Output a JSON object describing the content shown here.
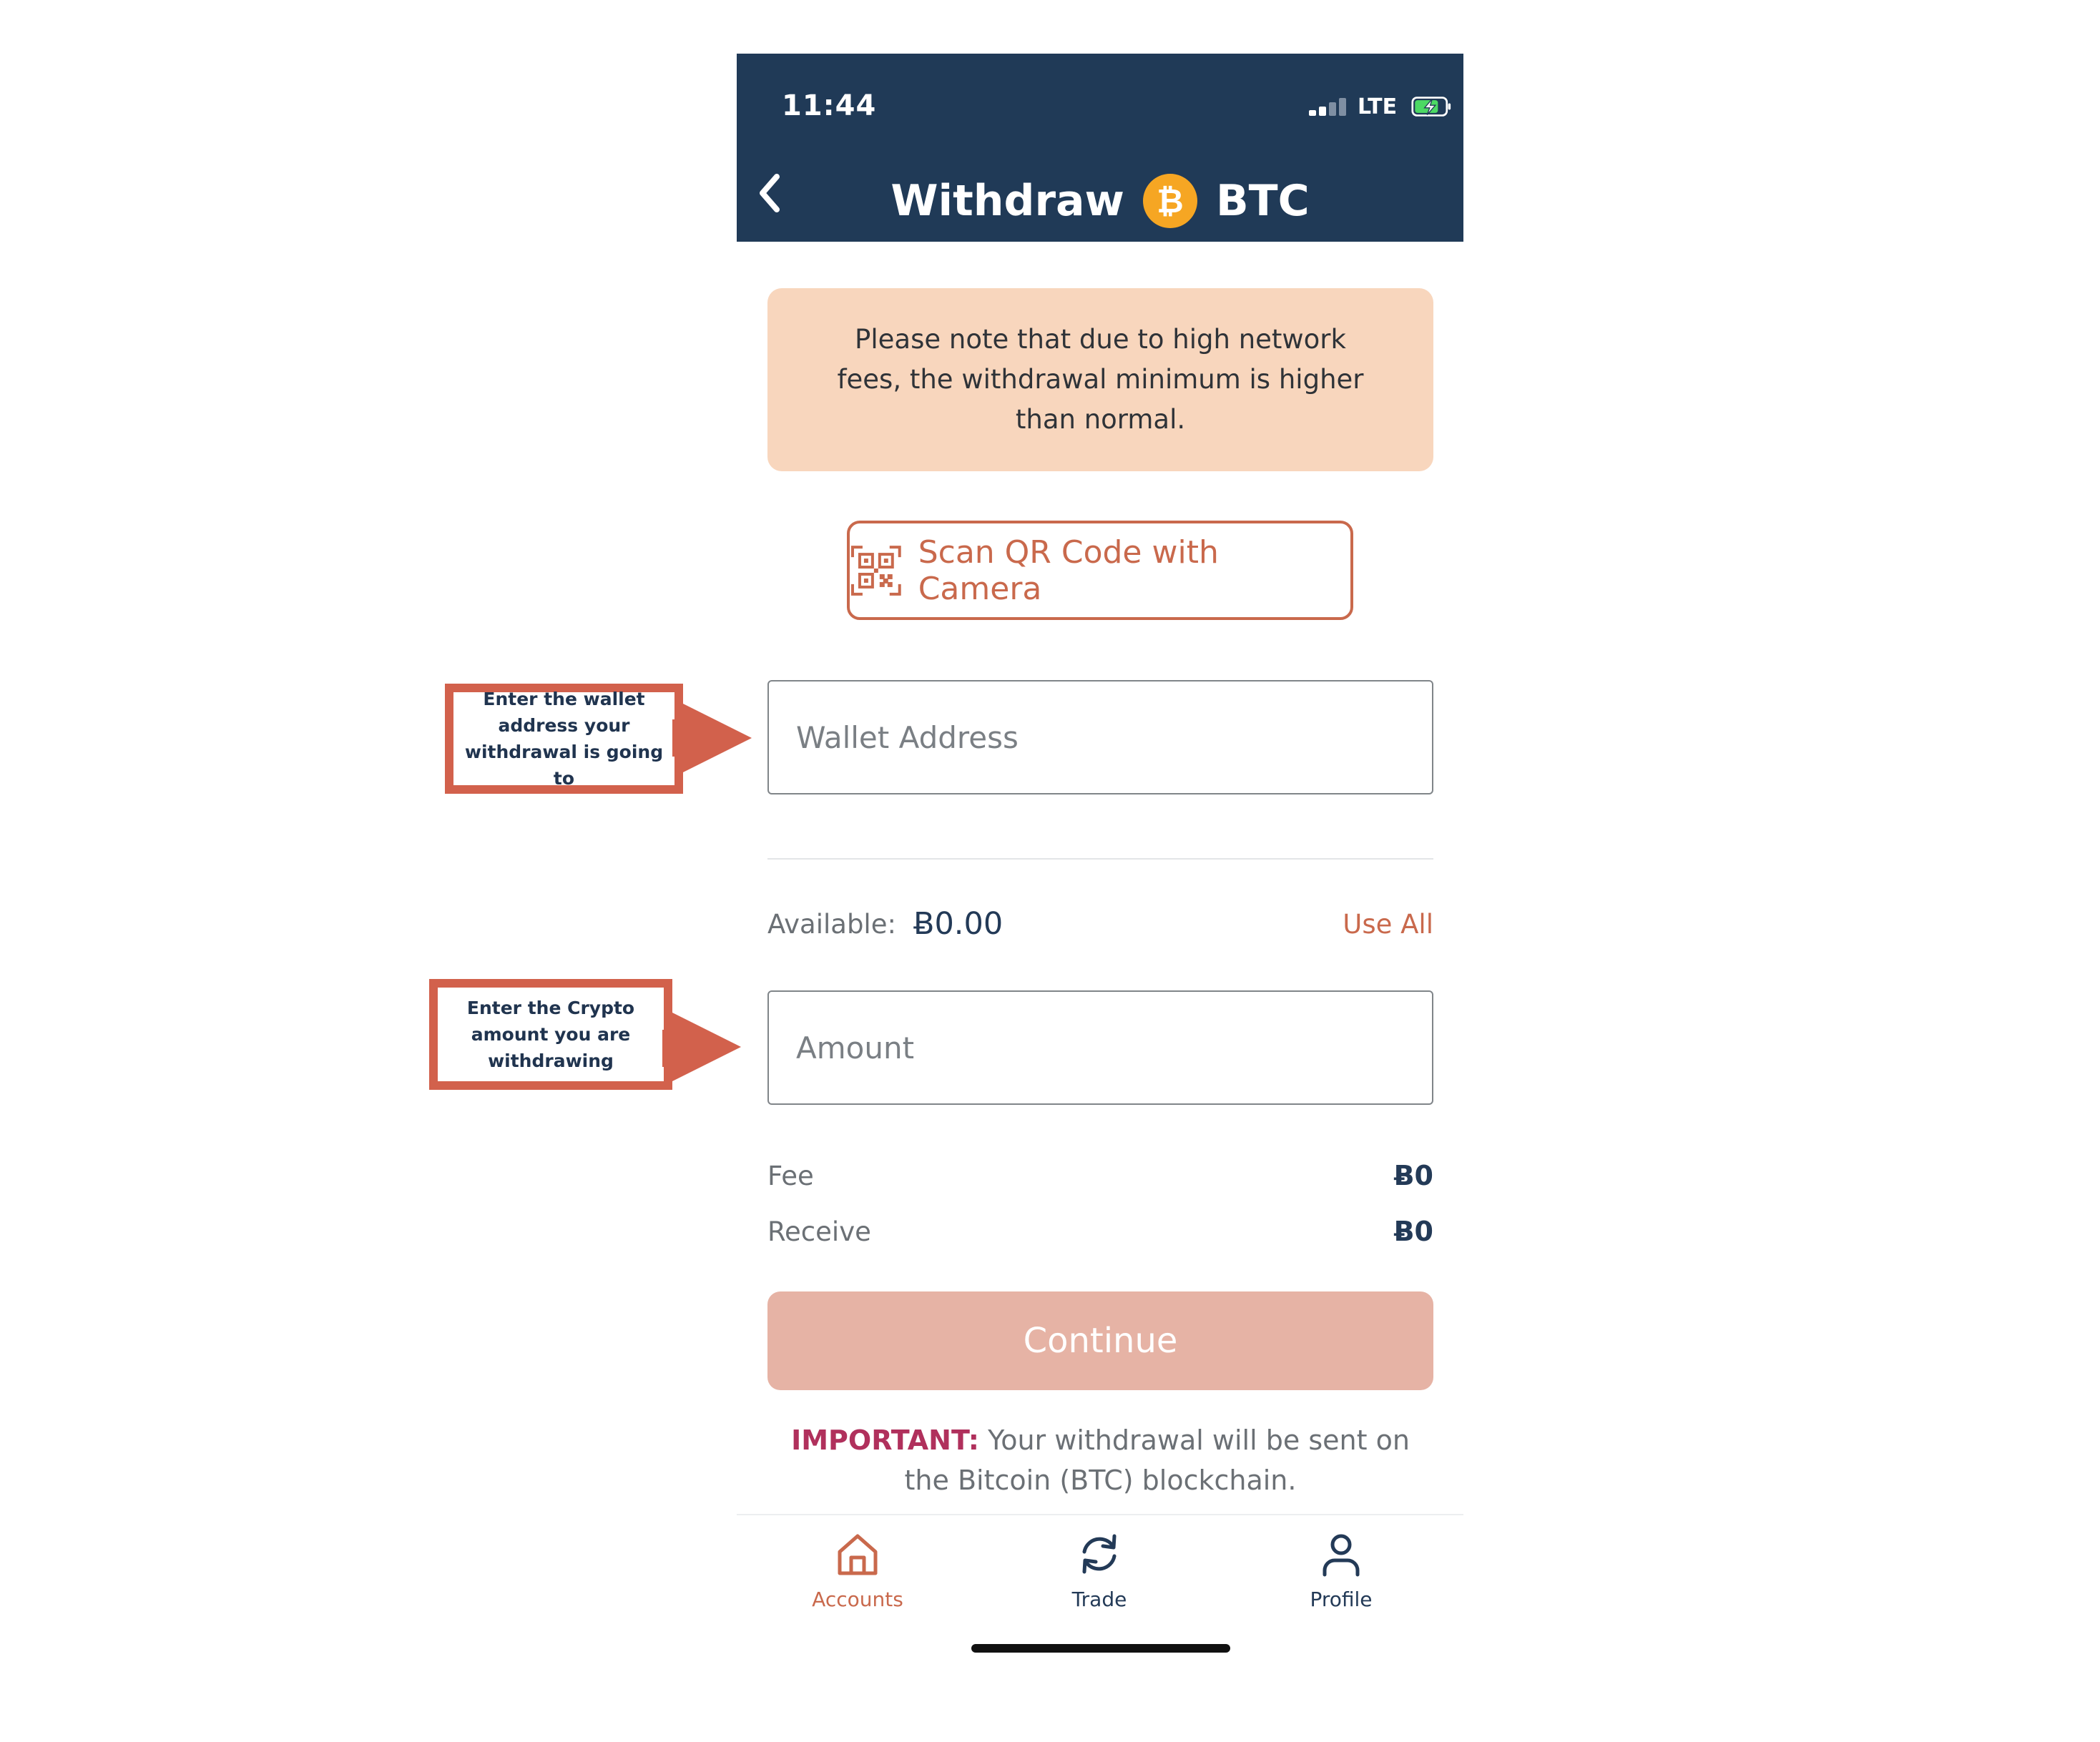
{
  "status_bar": {
    "time": "11:44",
    "network": "LTE"
  },
  "header": {
    "title": "Withdraw",
    "currency": "BTC",
    "currency_symbol": "₿"
  },
  "notice": {
    "text": "Please note that due to high network fees, the withdrawal minimum is higher than normal."
  },
  "scan_button": {
    "label": "Scan QR Code with Camera"
  },
  "wallet_field": {
    "placeholder": "Wallet Address",
    "value": ""
  },
  "available": {
    "label": "Available:",
    "value": "Ƀ0.00",
    "use_all_label": "Use All"
  },
  "amount_field": {
    "placeholder": "Amount",
    "value": ""
  },
  "fee": {
    "label": "Fee",
    "value": "Ƀ0"
  },
  "receive": {
    "label": "Receive",
    "value": "Ƀ0"
  },
  "continue_button": {
    "label": "Continue"
  },
  "important": {
    "label": "IMPORTANT:",
    "text": " Your withdrawal will be sent on the Bitcoin (BTC) blockchain."
  },
  "nav": {
    "items": [
      {
        "label": "Accounts",
        "icon": "home-icon",
        "active": true
      },
      {
        "label": "Trade",
        "icon": "refresh-icon",
        "active": false
      },
      {
        "label": "Profile",
        "icon": "person-icon",
        "active": false
      }
    ]
  },
  "annotations": {
    "wallet": "Enter the wallet address your withdrawal is going to",
    "amount": "Enter the Crypto amount you are withdrawing"
  },
  "colors": {
    "header_bg": "#203a57",
    "accent": "#c9694c",
    "notice_bg": "#f8d6bd",
    "continue_disabled_bg": "#e6b3a5",
    "important_label": "#b0305c",
    "bitcoin_orange": "#f6a623",
    "callout_red": "#d2614c"
  }
}
